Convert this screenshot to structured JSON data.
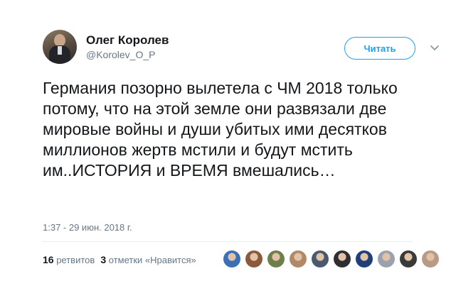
{
  "author": {
    "name": "Олег Королев",
    "handle": "@Korolev_O_P"
  },
  "follow_button": "Читать",
  "tweet_text": "Германия позорно вылетела с ЧМ 2018 только потому, что на этой земле они развязали две мировые войны и души убитых ими десятков миллионов жертв мстили и будут мстить им..ИСТОРИЯ и ВРЕМЯ вмешались…",
  "timestamp": "1:37 - 29 июн. 2018 г.",
  "stats": {
    "retweets_count": "16",
    "retweets_label": "ретвитов",
    "likes_count": "3",
    "likes_label": "отметки «Нравится»"
  },
  "liker_avatars": [
    {
      "color": "#3b6fb6"
    },
    {
      "color": "#8b5a3c"
    },
    {
      "color": "#6d7f4a"
    },
    {
      "color": "#b08968"
    },
    {
      "color": "#4a5a6e"
    },
    {
      "color": "#2e2e33"
    },
    {
      "color": "#1f3f7a"
    },
    {
      "color": "#9aa3ad"
    },
    {
      "color": "#3a3a3a"
    },
    {
      "color": "#b89a86"
    }
  ],
  "colors": {
    "accent": "#1da1f2",
    "text": "#14171a",
    "secondary": "#657786"
  }
}
